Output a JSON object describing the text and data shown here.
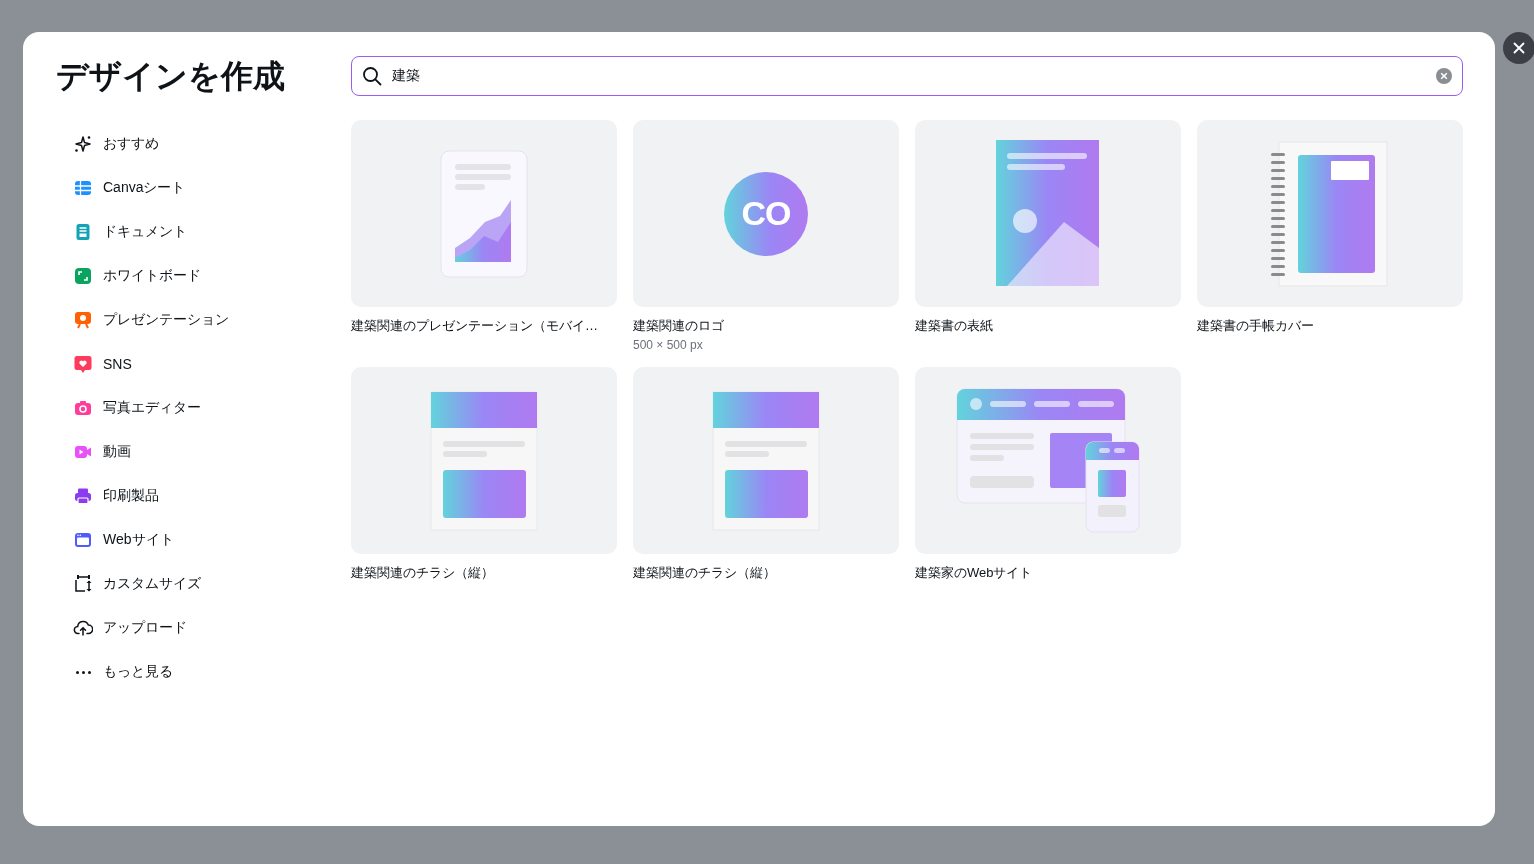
{
  "dialog": {
    "title": "デザインを作成"
  },
  "sidebar": {
    "items": [
      {
        "label": "おすすめ",
        "color": "#0e1318"
      },
      {
        "label": "Canvaシート",
        "color": "#1e90ff"
      },
      {
        "label": "ドキュメント",
        "color": "#13a3b5"
      },
      {
        "label": "ホワイトボード",
        "color": "#0ba360"
      },
      {
        "label": "プレゼンテーション",
        "color": "#ff6105"
      },
      {
        "label": "SNS",
        "color": "#fe3b5c"
      },
      {
        "label": "写真エディター",
        "color": "#ff3d9a"
      },
      {
        "label": "動画",
        "color": "#e950f7"
      },
      {
        "label": "印刷製品",
        "color": "#8c3cf0"
      },
      {
        "label": "Webサイト",
        "color": "#4f5bff"
      },
      {
        "label": "カスタムサイズ",
        "color": "#0e1318"
      },
      {
        "label": "アップロード",
        "color": "#0e1318"
      },
      {
        "label": "もっと見る",
        "color": "#0e1318"
      }
    ]
  },
  "search": {
    "value": "建築"
  },
  "templates": [
    {
      "kind": "presentation",
      "title": "建築関連のプレゼンテーション（モバイ…"
    },
    {
      "kind": "logo",
      "title": "建築関連のロゴ",
      "logo_text": "CO",
      "size": "500 × 500 px"
    },
    {
      "kind": "book-cover",
      "title": "建築書の表紙"
    },
    {
      "kind": "notebook",
      "title": "建築書の手帳カバー"
    },
    {
      "kind": "flyer",
      "title": "建築関連のチラシ（縦）"
    },
    {
      "kind": "flyer",
      "title": "建築関連のチラシ（縦）"
    },
    {
      "kind": "website",
      "title": "建築家のWebサイト"
    }
  ]
}
